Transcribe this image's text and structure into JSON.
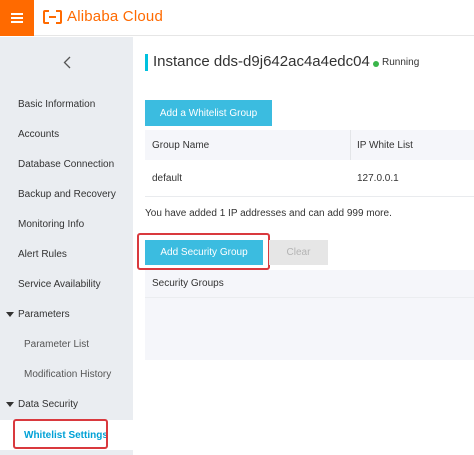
{
  "header": {
    "brand": "Alibaba Cloud",
    "brand_color": "#ff6a00",
    "menu_icon": "hamburger-icon"
  },
  "sidebar": {
    "back_icon": "chevron-left-icon",
    "items": [
      {
        "label": "Basic Information"
      },
      {
        "label": "Accounts"
      },
      {
        "label": "Database Connection"
      },
      {
        "label": "Backup and Recovery"
      },
      {
        "label": "Monitoring Info"
      },
      {
        "label": "Alert Rules"
      },
      {
        "label": "Service Availability"
      },
      {
        "label": "Parameters"
      },
      {
        "label": "Parameter List"
      },
      {
        "label": "Modification History"
      },
      {
        "label": "Data Security"
      },
      {
        "label": "Whitelist Settings"
      }
    ],
    "active_item": "Whitelist Settings"
  },
  "main": {
    "title": "Instance dds-d9j642ac4a4edc04",
    "status": "Running",
    "status_color": "#3ab54a",
    "add_whitelist_label": "Add a Whitelist Group",
    "whitelist_table": {
      "columns": [
        "Group Name",
        "IP White List"
      ],
      "rows": [
        {
          "group": "default",
          "ips": "127.0.0.1"
        }
      ]
    },
    "info_text": "You have added 1 IP addresses and can add 999 more.",
    "add_security_group_label": "Add Security Group",
    "clear_label": "Clear",
    "security_groups_header": "Security Groups",
    "accent_color": "#3bbce0",
    "highlight_color": "#d9393e"
  }
}
